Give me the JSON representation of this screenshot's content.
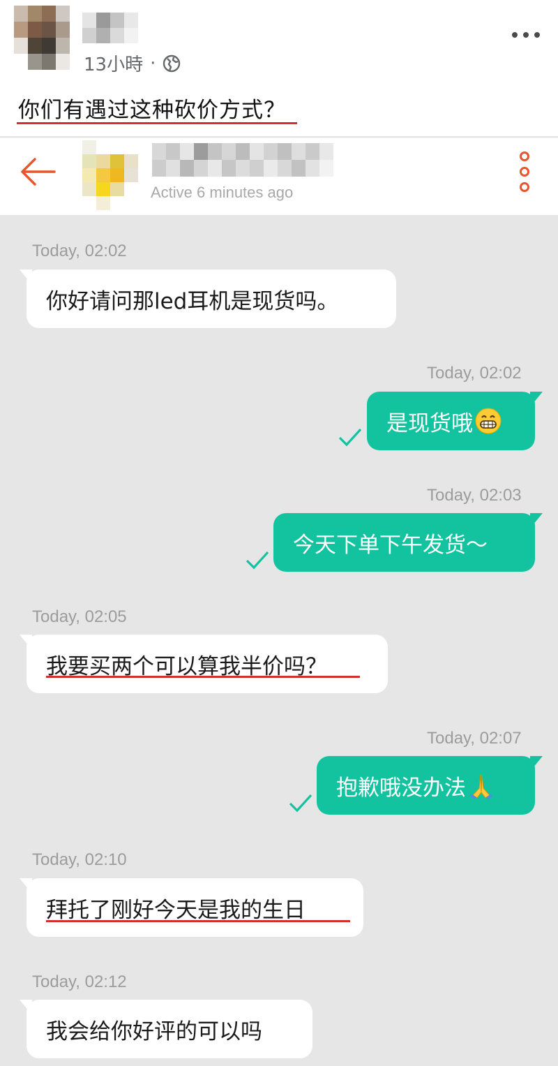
{
  "post": {
    "time": "13小時",
    "separator": "·",
    "text": "你们有遇过这种砍价方式？"
  },
  "chat": {
    "status": "Active 6 minutes ago",
    "accent_color": "#e8552d",
    "outgoing_color": "#13c3a0",
    "messages": [
      {
        "direction": "in",
        "timestamp": "Today, 02:02",
        "text": "你好请问那led耳机是现货吗。"
      },
      {
        "direction": "out",
        "timestamp": "Today, 02:02",
        "text": "是现货哦",
        "emoji": "grinning-face-icon",
        "read": true
      },
      {
        "direction": "out",
        "timestamp": "Today, 02:03",
        "text": "今天下单下午发货～",
        "read": true
      },
      {
        "direction": "in",
        "timestamp": "Today, 02:05",
        "text": "我要买两个可以算我半价吗？",
        "underlined": true
      },
      {
        "direction": "out",
        "timestamp": "Today, 02:07",
        "text": "抱歉哦没办法",
        "emoji": "folded-hands-icon",
        "read": true
      },
      {
        "direction": "in",
        "timestamp": "Today, 02:10",
        "text": "拜托了刚好今天是我的生日",
        "underlined": true
      },
      {
        "direction": "in",
        "timestamp": "Today, 02:12",
        "text": "我会给你好评的可以吗"
      }
    ]
  }
}
